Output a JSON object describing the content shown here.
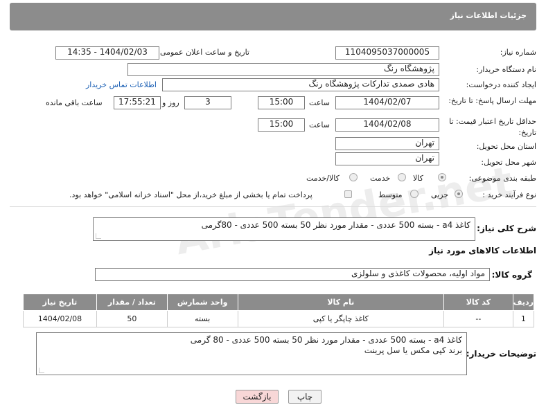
{
  "header": {
    "title": "جزئیات اطلاعات نیاز"
  },
  "form": {
    "need_number": {
      "label": "شماره نیاز:",
      "value": "1104095037000005"
    },
    "announce_datetime": {
      "label": "تاریخ و ساعت اعلان عمومی:",
      "value": "1404/02/03 - 14:35"
    },
    "buyer_org": {
      "label": "نام دستگاه خریدار:",
      "value": "پژوهشگاه رنگ"
    },
    "requester": {
      "label": "ایجاد کننده درخواست:",
      "value": "هادی صمدی تدارکات پژوهشگاه رنگ",
      "contact_link": "اطلاعات تماس خریدار"
    },
    "reply_deadline": {
      "label": "مهلت ارسال پاسخ: تا تاریخ:",
      "date": "1404/02/07",
      "time_label": "ساعت",
      "time": "15:00",
      "days": "3",
      "days_label": "روز و",
      "remaining": "17:55:21",
      "remaining_label": "ساعت باقی مانده"
    },
    "price_validity": {
      "label": "حداقل تاریخ اعتبار قیمت: تا تاریخ:",
      "date": "1404/02/08",
      "time_label": "ساعت",
      "time": "15:00"
    },
    "delivery_province": {
      "label": "استان محل تحویل:",
      "value": "تهران"
    },
    "delivery_city": {
      "label": "شهر محل تحویل:",
      "value": "تهران"
    },
    "category": {
      "label": "طبقه بندی موضوعی:",
      "options": [
        "کالا",
        "خدمت",
        "کالا/خدمت"
      ],
      "selected": "کالا"
    },
    "purchase_type": {
      "label": "نوع فرآیند خرید :",
      "options": [
        "جزیی",
        "متوسط"
      ],
      "selected": "جزیی",
      "payment_note": "پرداخت تمام یا بخشی از مبلغ خرید،از محل \"اسناد خزانه اسلامی\" خواهد بود."
    },
    "description": {
      "label": "شرح کلی نیاز:",
      "value": "کاغذ a4 - بسته 500 عددی - مقدار مورد نظر 50 بسته 500 عددی - 80گرمی"
    }
  },
  "goods": {
    "section_title": "اطلاعات کالاهای مورد نیاز",
    "group_label": "گروه کالا:",
    "group_value": "مواد اولیه، محصولات کاغذی و سلولزی",
    "table": {
      "headers": [
        "ردیف",
        "کد کالا",
        "نام کالا",
        "واحد شمارش",
        "تعداد / مقدار",
        "تاریخ نیاز"
      ],
      "rows": [
        [
          "1",
          "--",
          "کاغذ چاپگر یا کپی",
          "بسته",
          "50",
          "1404/02/08"
        ]
      ]
    },
    "buyer_notes_label": "توضیحات خریدار:",
    "buyer_notes_line1": "کاغذ a4 - بسته 500 عددی - مقدار مورد نظر 50 بسته 500 عددی - 80 گرمی",
    "buyer_notes_line2": "برند کپی مکس یا سل پرینت"
  },
  "buttons": {
    "print": "چاپ",
    "back": "بازگشت"
  },
  "watermark": "AriaTender.net"
}
